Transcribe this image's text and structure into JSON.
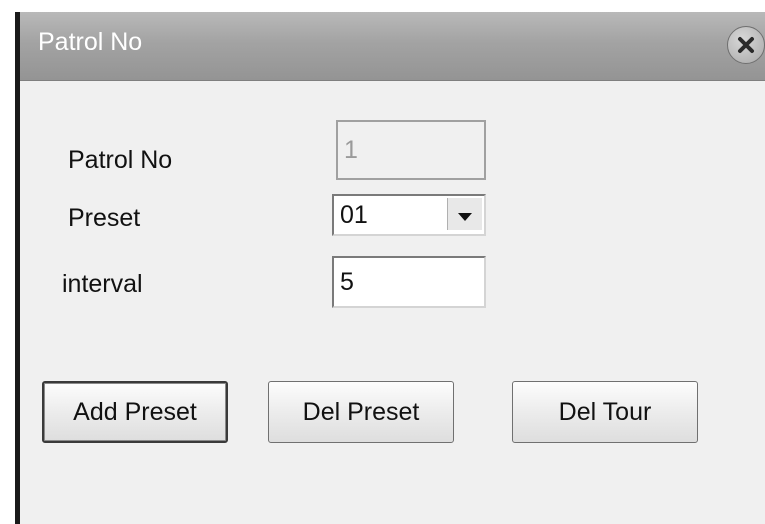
{
  "window": {
    "title": "Patrol No",
    "close_icon": "close-icon"
  },
  "form": {
    "patrol_no_label": "Patrol No",
    "patrol_no_value": "1",
    "preset_label": "Preset",
    "preset_value": "01",
    "interval_label": "interval",
    "interval_value": "5"
  },
  "buttons": {
    "add_preset": "Add Preset",
    "del_preset": "Del Preset",
    "del_tour": "Del Tour"
  }
}
